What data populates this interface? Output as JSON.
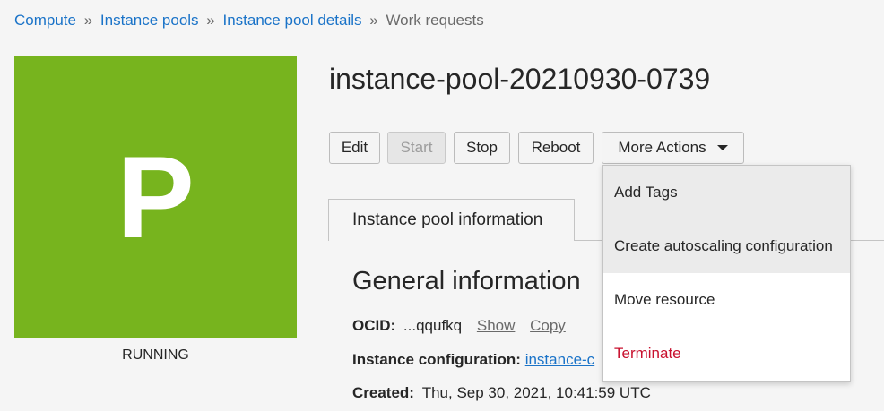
{
  "breadcrumb": {
    "items": [
      "Compute",
      "Instance pools",
      "Instance pool details"
    ],
    "separator": "»",
    "current": "Work requests"
  },
  "badge": {
    "letter": "P",
    "color": "#77b41e",
    "status": "RUNNING"
  },
  "title": "instance-pool-20210930-0739",
  "actions": {
    "edit": "Edit",
    "start": "Start",
    "stop": "Stop",
    "reboot": "Reboot",
    "more": "More Actions"
  },
  "tabs": {
    "active": "Instance pool information"
  },
  "general": {
    "heading": "General information",
    "ocid_label": "OCID:",
    "ocid_value": "...qqufkq",
    "show": "Show",
    "copy": "Copy",
    "config_label": "Instance configuration:",
    "config_value": "instance-c",
    "created_label": "Created:",
    "created_value": "Thu, Sep 30, 2021, 10:41:59 UTC"
  },
  "menu": {
    "items": [
      {
        "label": "Add Tags"
      },
      {
        "label": "Create autoscaling configuration"
      },
      {
        "label": "Move resource"
      },
      {
        "label": "Terminate"
      }
    ]
  },
  "colors": {
    "link": "#1a73c8",
    "danger": "#c8102e",
    "brand": "#77b41e"
  }
}
